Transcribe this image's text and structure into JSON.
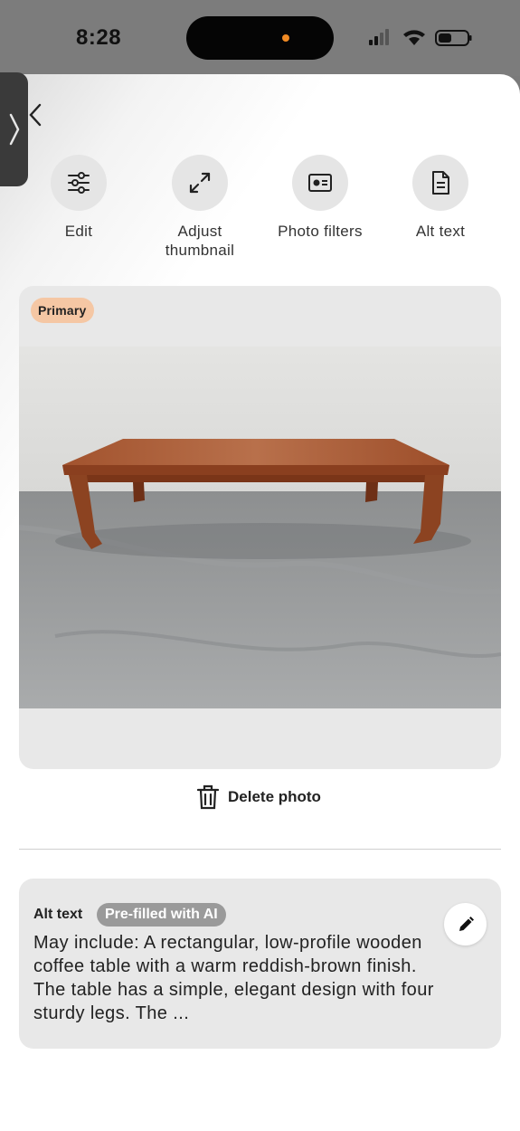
{
  "status_bar": {
    "time": "8:28"
  },
  "toolbar": {
    "items": [
      {
        "label": "Edit",
        "icon": "sliders-icon"
      },
      {
        "label": "Adjust thumbnail",
        "icon": "expand-arrows-icon"
      },
      {
        "label": "Photo filters",
        "icon": "photo-filter-icon"
      },
      {
        "label": "Alt text",
        "icon": "document-icon"
      }
    ]
  },
  "photo_card": {
    "badge": "Primary"
  },
  "actions": {
    "delete_label": "Delete photo"
  },
  "alt_text_card": {
    "title": "Alt text",
    "badge": "Pre-filled with AI",
    "body": "May include: A rectangular, low-profile wooden coffee table with a warm reddish-brown finish. The table has a simple, elegant design with four sturdy legs. The ..."
  },
  "colors": {
    "primary_badge": "#f5c7a4",
    "ai_badge": "#9a9a9a",
    "card_background": "#e8e8e8",
    "island_dot": "#f08a24"
  }
}
